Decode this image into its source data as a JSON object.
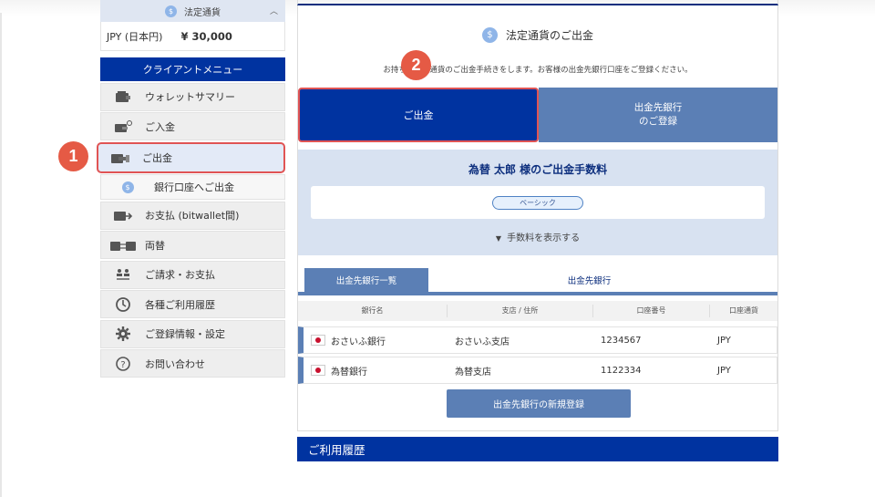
{
  "sidebar": {
    "currency_header": "法定通貨",
    "balance_currency": "JPY (日本円)",
    "balance_amount": "¥ 30,000",
    "menu_header": "クライアントメニュー",
    "items": [
      {
        "label": "ウォレットサマリー",
        "icon": "wallet-icon"
      },
      {
        "label": "ご入金",
        "icon": "deposit-icon"
      },
      {
        "label": "ご出金",
        "icon": "withdraw-icon"
      },
      {
        "label": "銀行口座へご出金",
        "icon": "coin-icon"
      },
      {
        "label": "お支払 (bitwallet間)",
        "icon": "payment-icon"
      },
      {
        "label": "両替",
        "icon": "exchange-icon"
      },
      {
        "label": "ご請求・お支払",
        "icon": "transfer-users-icon"
      },
      {
        "label": "各種ご利用履歴",
        "icon": "history-icon"
      },
      {
        "label": "ご登録情報・設定",
        "icon": "gear-icon"
      },
      {
        "label": "お問い合わせ",
        "icon": "help-icon"
      }
    ]
  },
  "steps": {
    "one": "1",
    "two": "2"
  },
  "main": {
    "title": "法定通貨のご出金",
    "description": "お持ちの法定通貨のご出金手続きをします。お客様の出金先銀行口座をご登録ください。",
    "tabs": {
      "withdraw": "ご出金",
      "register_line1": "出金先銀行",
      "register_line2": "のご登録"
    },
    "fee": {
      "title": "為替 太郎 様のご出金手数料",
      "plan": "ベーシック",
      "toggle": "手数料を表示する"
    },
    "subtabs": {
      "list": "出金先銀行一覧",
      "bank": "出金先銀行"
    },
    "table": {
      "headers": [
        "銀行名",
        "支店 / 住所",
        "口座番号",
        "口座通貨"
      ],
      "rows": [
        {
          "bank": "おさいふ銀行",
          "branch": "おさいふ支店",
          "account": "1234567",
          "currency": "JPY"
        },
        {
          "bank": "為替銀行",
          "branch": "為替支店",
          "account": "1122334",
          "currency": "JPY"
        }
      ]
    },
    "register_button": "出金先銀行の新規登録",
    "history_title": "ご利用履歴"
  },
  "colors": {
    "navy": "#0033a0",
    "steel_blue": "#5b7fb5",
    "highlight_red": "#e05454",
    "badge": "#e55a45"
  }
}
